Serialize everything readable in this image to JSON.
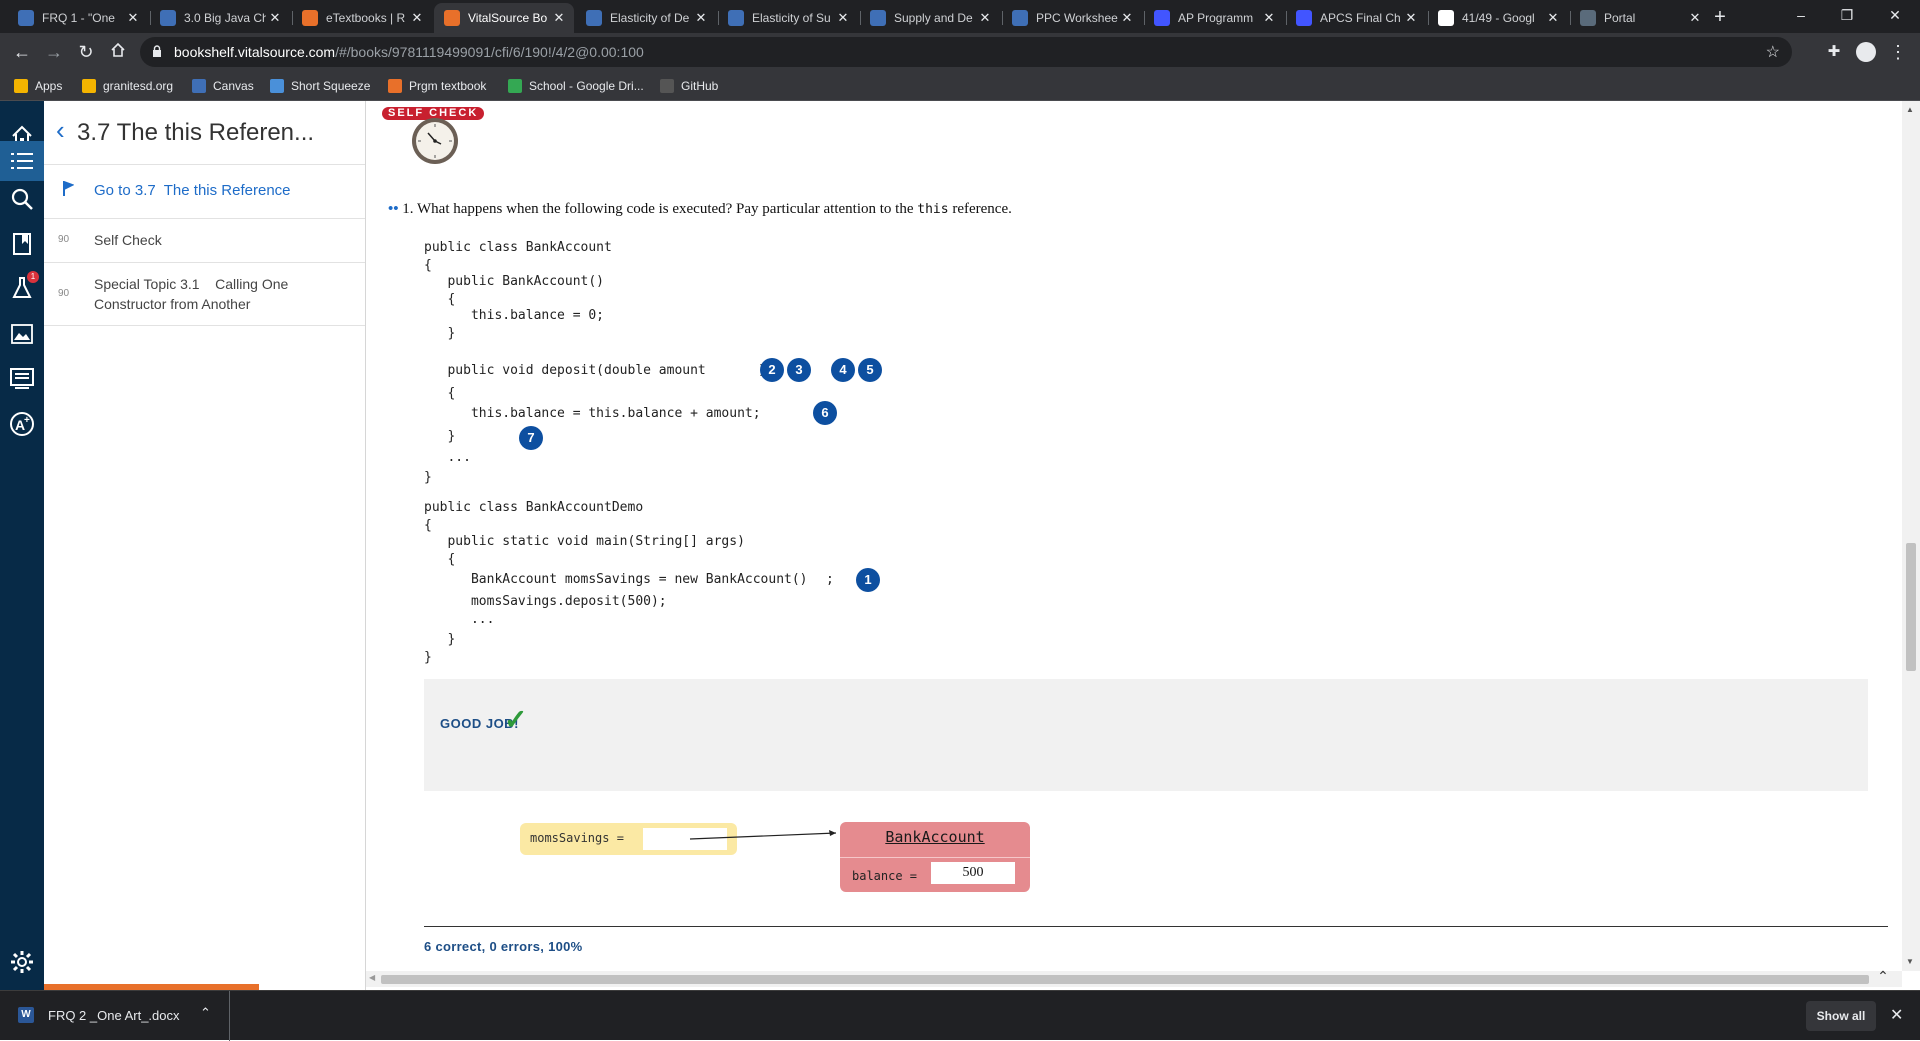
{
  "browser": {
    "tabs": [
      {
        "title": "FRQ 1 - \"One",
        "icon": "canvas-icon",
        "color": "#3f6fb6"
      },
      {
        "title": "3.0 Big Java Ch",
        "icon": "canvas-icon",
        "color": "#3f6fb6"
      },
      {
        "title": "eTextbooks | R",
        "icon": "vitalsource-icon",
        "color": "#e8702a"
      },
      {
        "title": "VitalSource Bo",
        "icon": "bookmark-icon",
        "color": "#e8702a",
        "active": true
      },
      {
        "title": "Elasticity of De",
        "icon": "canvas-icon",
        "color": "#3f6fb6"
      },
      {
        "title": "Elasticity of Su",
        "icon": "canvas-icon",
        "color": "#3f6fb6"
      },
      {
        "title": "Supply and De",
        "icon": "canvas-icon",
        "color": "#3f6fb6"
      },
      {
        "title": "PPC Workshee",
        "icon": "canvas-icon",
        "color": "#3f6fb6"
      },
      {
        "title": "AP Programm",
        "icon": "quizlet-icon",
        "color": "#4255ff"
      },
      {
        "title": "APCS Final Ch",
        "icon": "quizlet-icon",
        "color": "#4255ff"
      },
      {
        "title": "41/49 - Googl",
        "icon": "google-icon",
        "color": "#ffffff"
      },
      {
        "title": "Portal",
        "icon": "esd-icon",
        "color": "#5a6b7b"
      }
    ],
    "url_domain": "bookshelf.vitalsource.com",
    "url_path": "/#/books/9781119499091/cfi/6/190!/4/2@0.00:100",
    "bookmarks": [
      {
        "label": "Apps",
        "color": "#f4b400"
      },
      {
        "label": "granitesd.org",
        "color": "#f4b400"
      },
      {
        "label": "Canvas",
        "color": "#3f6fb6"
      },
      {
        "label": "Short Squeeze",
        "color": "#4a90d9"
      },
      {
        "label": "Prgm textbook",
        "color": "#e8702a"
      },
      {
        "label": "School - Google Dri...",
        "color": "#34a853"
      },
      {
        "label": "GitHub",
        "color": "#555555"
      }
    ]
  },
  "toc": {
    "title": "3.7  The this Referen...",
    "goto": "Go to 3.7  The this Reference",
    "items": [
      {
        "page": "90",
        "label": "Self Check"
      },
      {
        "page": "90",
        "label": "Special Topic 3.1    Calling One Constructor from Another"
      }
    ]
  },
  "content": {
    "badge": "SELF CHECK",
    "question_num": "1.",
    "question_text": "What happens when the following code is executed? Pay particular attention to the ",
    "question_code": "this",
    "question_end": " reference.",
    "code": [
      "public class BankAccount",
      "{",
      "   public BankAccount()",
      "   {",
      "      this.balance = 0;",
      "   }",
      "   public void deposit(double amount",
      ")",
      "   {",
      "      this.balance = this.balance + amount;",
      "   }",
      "   ...",
      "}",
      "public class BankAccountDemo",
      "{",
      "   public static void main(String[] args)",
      "   {",
      "      BankAccount momsSavings = new BankAccount()",
      ";",
      "      momsSavings.deposit(500);",
      "      ...",
      "   }",
      "}"
    ],
    "steps": [
      "1",
      "2",
      "3",
      "4",
      "5",
      "6",
      "7"
    ],
    "feedback": "GOOD JOB!",
    "diagram": {
      "var_label": "momsSavings =",
      "class_name": "BankAccount",
      "field_label": "balance =",
      "field_value": "500"
    },
    "score": "6 correct, 0 errors, 100%"
  },
  "download": {
    "file": "FRQ 2 _One Art_.docx",
    "show_all": "Show all"
  }
}
